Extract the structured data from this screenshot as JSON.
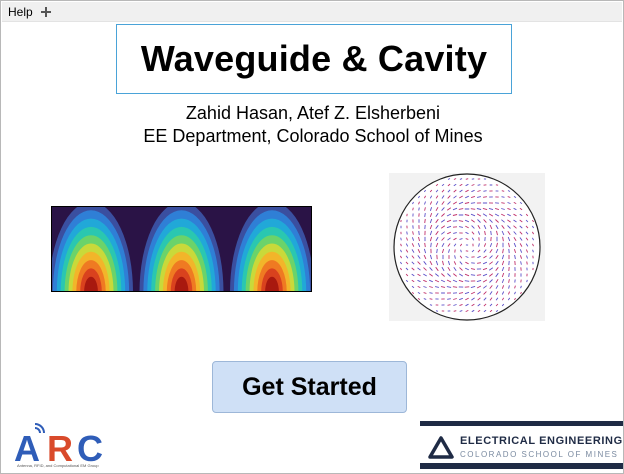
{
  "menubar": {
    "help_label": "Help",
    "add_icon": "plus-icon"
  },
  "title": "Waveguide & Cavity",
  "authors": "Zahid Hasan, Atef Z. Elsherbeni",
  "department": "EE Department, Colorado School of Mines",
  "start_button": {
    "label": "Get Started"
  },
  "logos": {
    "arc": {
      "text": "ARC",
      "caption": "Antenna, RFID, and Computational EM Group"
    },
    "ee": {
      "line1": "ELECTRICAL ENGINEERING",
      "line2": "COLORADO SCHOOL OF MINES"
    }
  },
  "colors": {
    "title_border": "#4aa3d8",
    "button_bg": "#cfe0f6",
    "ee_navy": "#1f2b45",
    "arc_blue": "#2f5db8",
    "arc_red": "#d94a2b"
  }
}
